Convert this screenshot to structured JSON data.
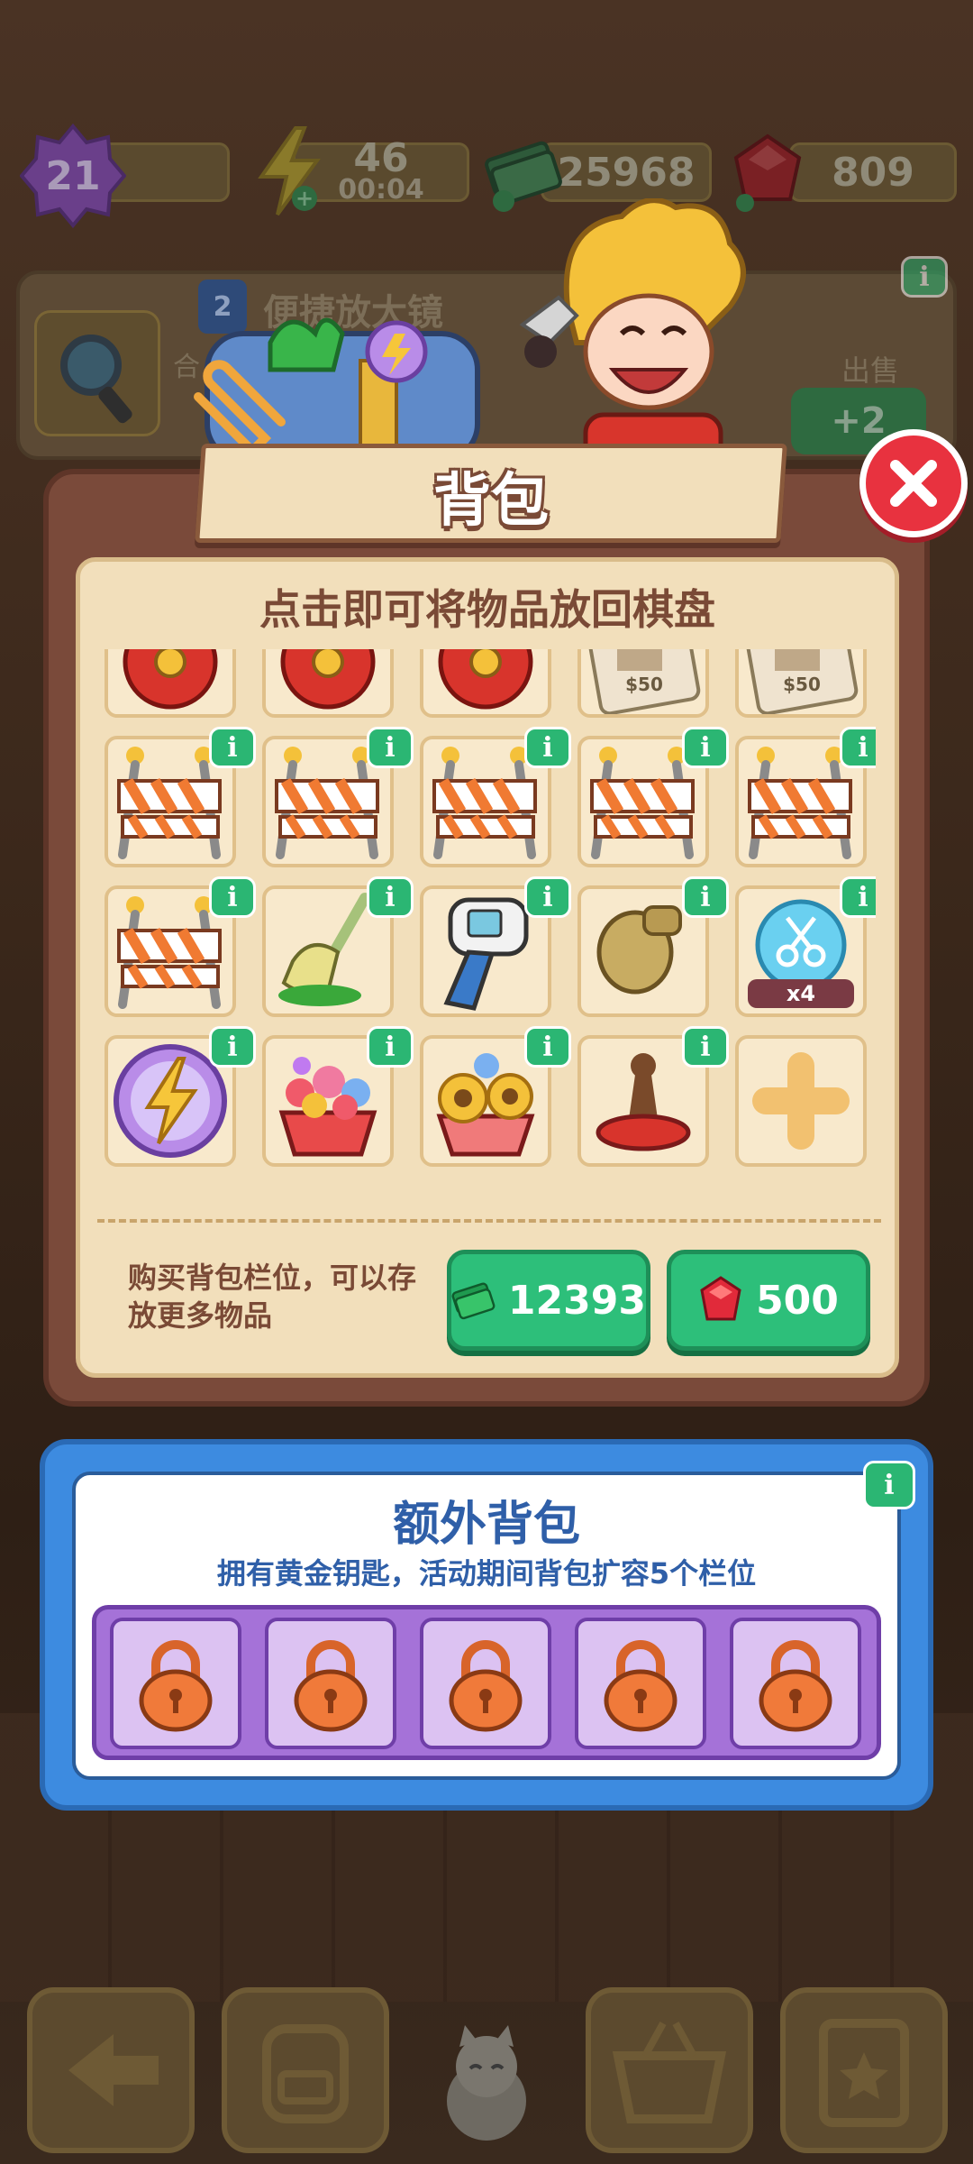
{
  "resources": {
    "level": "21",
    "energy": "46",
    "energy_timer": "00:04",
    "cash": "25968",
    "gems": "809"
  },
  "background_card": {
    "level": "2",
    "title": "便捷放大镜",
    "subtitle": "合",
    "sell_label": "出售",
    "sell_value": "+2"
  },
  "backpack": {
    "title": "背包",
    "hint": "点击即可将物品放回棋盘",
    "info_icon": "i",
    "rows": [
      [
        {
          "icon": "red-fire-hydrant-icon"
        },
        {
          "icon": "red-fire-hydrant-icon"
        },
        {
          "icon": "red-fire-hydrant-icon"
        },
        {
          "icon": "bill-stub-icon"
        },
        {
          "icon": "bill-stub-icon"
        }
      ],
      [
        {
          "icon": "road-barrier-icon",
          "info": true
        },
        {
          "icon": "road-barrier-icon",
          "info": true
        },
        {
          "icon": "road-barrier-icon",
          "info": true
        },
        {
          "icon": "road-barrier-icon",
          "info": true
        },
        {
          "icon": "road-barrier-icon",
          "info": true
        }
      ],
      [
        {
          "icon": "road-barrier-icon",
          "info": true
        },
        {
          "icon": "broom-icon",
          "info": true
        },
        {
          "icon": "thermometer-gun-icon",
          "info": true
        },
        {
          "icon": "sandbag-icon",
          "info": true
        },
        {
          "icon": "scissors-bubble-icon",
          "info": true,
          "badge": "x4"
        }
      ],
      [
        {
          "icon": "lightning-orb-icon",
          "info": true
        },
        {
          "icon": "flower-basket-icon",
          "info": true
        },
        {
          "icon": "sunflower-basket-icon",
          "info": true
        },
        {
          "icon": "chess-pawn-icon",
          "info": true
        },
        {
          "icon": "plus-icon",
          "add": true
        }
      ]
    ],
    "buy_text": "购买背包栏位，可以存放更多物品",
    "buy_cash": "12393",
    "buy_gems": "500"
  },
  "extra": {
    "title": "额外背包",
    "subtitle": "拥有黄金钥匙，活动期间背包扩容5个栏位",
    "slots": 5
  },
  "colors": {
    "info_green": "#2bb673",
    "buy_green": "#2dbf7a",
    "close_red": "#e8323f",
    "extra_blue": "#3d8be0"
  }
}
